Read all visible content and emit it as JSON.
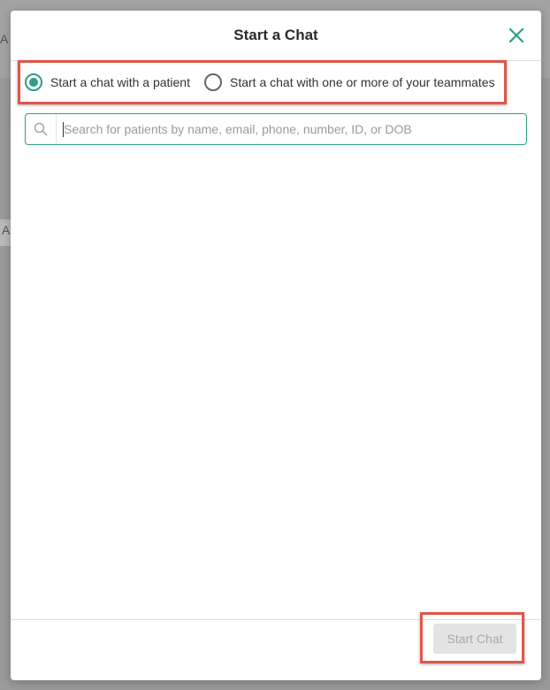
{
  "background": {
    "letter_top": "A",
    "letter_mid": "A"
  },
  "modal": {
    "title": "Start a Chat",
    "close_icon": "close-icon"
  },
  "recipient_options": [
    {
      "label": "Start a chat with a patient",
      "selected": true
    },
    {
      "label": "Start a chat with one or more of your teammates",
      "selected": false
    }
  ],
  "search": {
    "placeholder": "Search for patients by name, email, phone, number, ID, or DOB",
    "value": "",
    "icon": "search-icon"
  },
  "footer": {
    "start_label": "Start Chat",
    "start_disabled": true
  },
  "colors": {
    "accent": "#2f9e86",
    "highlight": "#e0574a",
    "disabled_bg": "#e4e4e4",
    "disabled_text": "#a8a8a8"
  }
}
